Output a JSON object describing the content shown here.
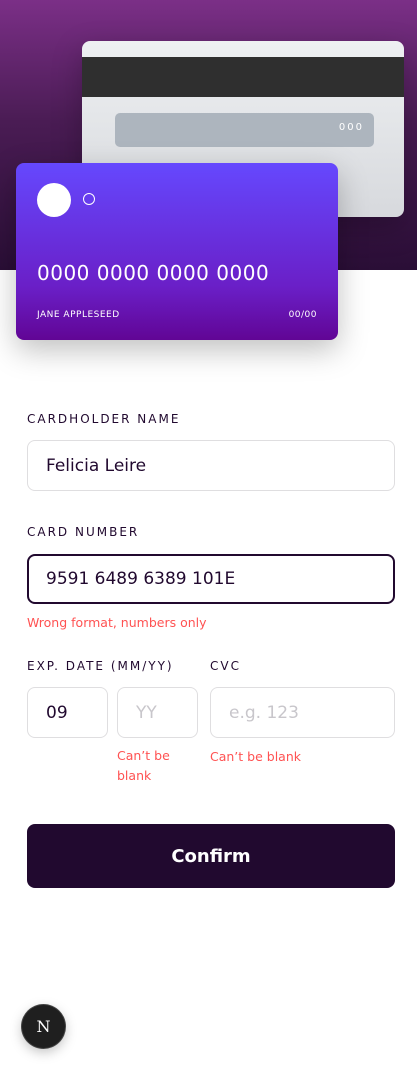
{
  "card_back": {
    "cvc": "000"
  },
  "card_front": {
    "number": "0000 0000 0000 0000",
    "name": "JANE APPLESEED",
    "expiry": "00/00"
  },
  "form": {
    "name_label": "CARDHOLDER NAME",
    "name_value": "Felicia Leire",
    "number_label": "CARD NUMBER",
    "number_value": "9591 6489 6389 101E",
    "number_error": "Wrong format, numbers only",
    "exp_label": "EXP. DATE (MM/YY)",
    "month_value": "09",
    "year_placeholder": "YY",
    "year_error_line1": "Can’t be",
    "year_error_line2": "blank",
    "cvc_label": "CVC",
    "cvc_placeholder": "e.g. 123",
    "cvc_error": "Can’t be blank",
    "confirm_label": "Confirm"
  },
  "badge": {
    "letter": "N"
  },
  "colors": {
    "accent_dark": "#21092f",
    "error": "#ff5252",
    "card_gradient_start": "#6548fe",
    "card_gradient_end": "#610595"
  }
}
